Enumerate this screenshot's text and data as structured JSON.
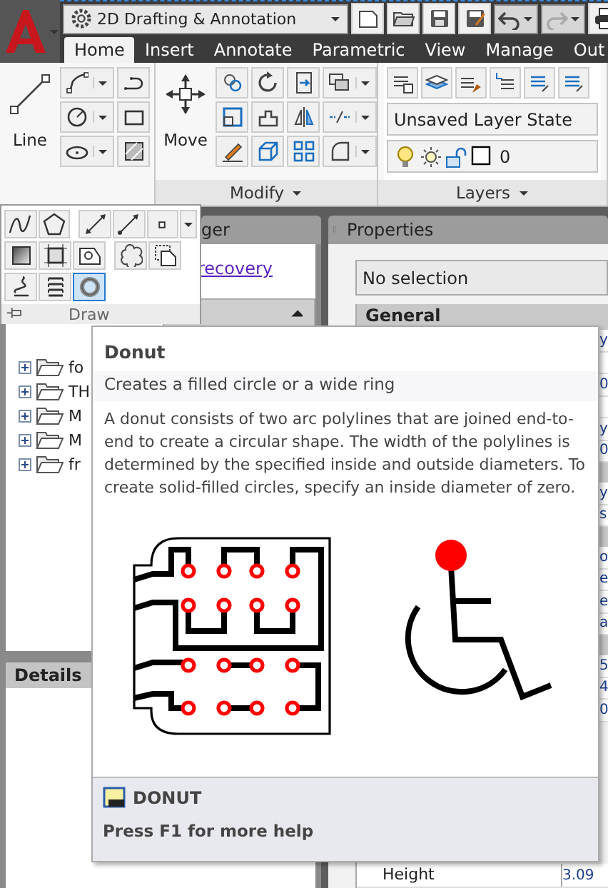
{
  "workspace": {
    "value": "2D Drafting & Annotation"
  },
  "tabs": [
    {
      "label": "Home",
      "selected": true
    },
    {
      "label": "Insert",
      "selected": false
    },
    {
      "label": "Annotate",
      "selected": false
    },
    {
      "label": "Parametric",
      "selected": false
    },
    {
      "label": "View",
      "selected": false
    },
    {
      "label": "Manage",
      "selected": false
    },
    {
      "label": "Out",
      "selected": false
    }
  ],
  "ribbon": {
    "line_label": "Line",
    "move_label": "Move",
    "panels": [
      {
        "title": "Modify"
      },
      {
        "title": "Layers"
      }
    ],
    "layer_state": "Unsaved Layer State",
    "current_layer": "0"
  },
  "draw_panel": {
    "title": "Draw",
    "tools": [
      {
        "kind": "spline",
        "selected": false
      },
      {
        "kind": "polygon",
        "selected": false
      },
      {
        "kind": "construction",
        "selected": false
      },
      {
        "kind": "ray",
        "selected": false
      },
      {
        "kind": "point",
        "selected": false
      },
      {
        "kind": "gradient",
        "selected": false
      },
      {
        "kind": "boundary",
        "selected": false
      },
      {
        "kind": "region",
        "selected": false
      },
      {
        "kind": "cloud",
        "selected": false
      },
      {
        "kind": "wipeout",
        "selected": false
      },
      {
        "kind": "helix",
        "selected": false
      },
      {
        "kind": "coil",
        "selected": false
      },
      {
        "kind": "donut",
        "selected": true
      }
    ]
  },
  "palette": {
    "tab": "ger",
    "link": "recovery",
    "tree": [
      {
        "label": "fo",
        "expanded": false
      },
      {
        "label": "TH",
        "expanded": false
      },
      {
        "label": "M",
        "expanded": false
      },
      {
        "label": "M",
        "expanded": false
      },
      {
        "label": "fr",
        "expanded": false
      }
    ],
    "details": "Details"
  },
  "properties": {
    "title": "Properties",
    "selection": "No selection",
    "section": "General",
    "rows": [
      {
        "kind": "row",
        "value": "y"
      },
      {
        "kind": "row"
      },
      {
        "kind": "row",
        "value": "0"
      },
      {
        "kind": "row"
      },
      {
        "kind": "row",
        "value": "y"
      },
      {
        "kind": "row",
        "value": "0"
      },
      {
        "kind": "section"
      },
      {
        "kind": "row",
        "value": "y"
      },
      {
        "kind": "row",
        "value": "s"
      },
      {
        "kind": "section"
      },
      {
        "kind": "row",
        "value": "o"
      },
      {
        "kind": "row",
        "value": "e"
      },
      {
        "kind": "row",
        "value": "e"
      },
      {
        "kind": "row",
        "value": "a"
      },
      {
        "kind": "section"
      },
      {
        "kind": "row",
        "value": "5"
      },
      {
        "kind": "row",
        "value": "4"
      },
      {
        "kind": "row",
        "value": "0"
      }
    ],
    "last_row": {
      "label": "Height",
      "value": "3.09"
    }
  },
  "tooltip": {
    "title": "Donut",
    "summary": "Creates a filled circle or a wide ring",
    "description": "A donut consists of two arc polylines that are joined end-to-end to create a circular shape. The width of the polylines is determined by the specified inside and outside diameters. To create solid-filled circles, specify an inside diameter of zero.",
    "command": "DONUT",
    "help": "Press F1 for more help"
  }
}
